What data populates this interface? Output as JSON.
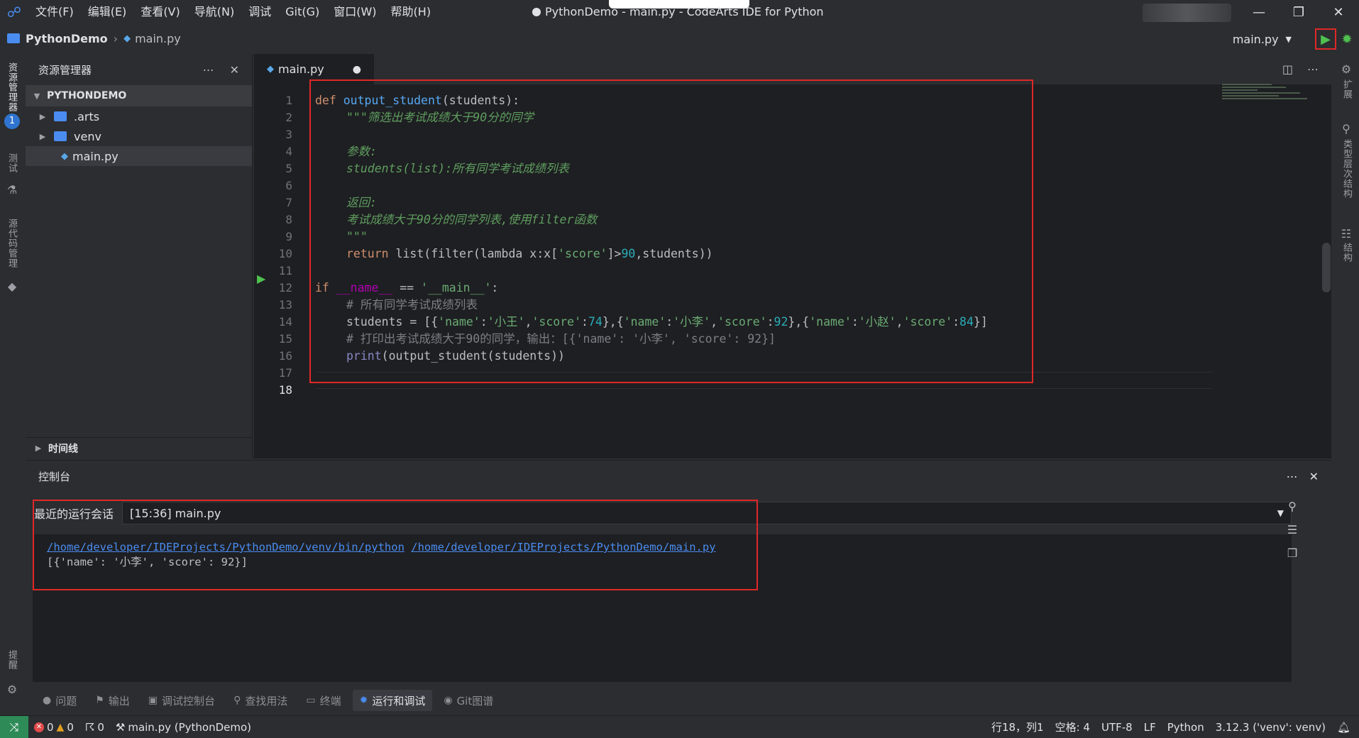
{
  "titlebar": {
    "menus": [
      "文件(F)",
      "编辑(E)",
      "查看(V)",
      "导航(N)",
      "调试",
      "Git(G)",
      "窗口(W)",
      "帮助(H)"
    ],
    "title": "PythonDemo - main.py - CodeArts IDE for Python"
  },
  "breadcrumb": {
    "project": "PythonDemo",
    "file": "main.py"
  },
  "run_config": {
    "selected": "main.py"
  },
  "activity": {
    "explorer_label": "资源管理器",
    "badge": "1",
    "test_label": "测试",
    "scm_label": "源代码管理",
    "bottom_label": "提醒"
  },
  "right_strip": {
    "ext_label": "扩展",
    "hier_label": "类型层次结构",
    "struct_label": "结构"
  },
  "explorer": {
    "title": "资源管理器",
    "project": "PYTHONDEMO",
    "items": [
      ".arts",
      "venv",
      "main.py"
    ],
    "timeline": "时间线"
  },
  "editor": {
    "tab": "main.py",
    "modified": "●",
    "line_numbers": [
      "1",
      "2",
      "3",
      "4",
      "5",
      "6",
      "7",
      "8",
      "9",
      "10",
      "11",
      "12",
      "13",
      "14",
      "15",
      "16",
      "17",
      "18"
    ],
    "code": {
      "l1_def": "def",
      "l1_fn": "output_student",
      "l1_rest": "(students):",
      "l2": "\"\"\"筛选出考试成绩大于90分的同学",
      "l4": "参数:",
      "l5": "students(list):所有同学考试成绩列表",
      "l7": "返回:",
      "l8": "考试成绩大于90分的同学列表,使用filter函数",
      "l9": "\"\"\"",
      "l10_kw": "return",
      "l10_a": "list(filter(lambda x:x[",
      "l10_s": "'score'",
      "l10_b": "]>",
      "l10_n": "90",
      "l10_c": ",students))",
      "l12_if": "if",
      "l12_name": "__name__",
      "l12_eq": " == ",
      "l12_s": "'__main__'",
      "l12_c": ":",
      "l13": "# 所有同学考试成绩列表",
      "l14_a": "students = [{",
      "l14_k1": "'name'",
      "l14_v1": "'小王'",
      "l14_k2": "'score'",
      "l14_n1": "74",
      "l14_k3": "'name'",
      "l14_v2": "'小李'",
      "l14_k4": "'score'",
      "l14_n2": "92",
      "l14_k5": "'name'",
      "l14_v3": "'小赵'",
      "l14_k6": "'score'",
      "l14_n3": "84",
      "l15": "# 打印出考试成绩大于90的同学，输出：[{'name': '小李', 'score': 92}]",
      "l16_fn": "print",
      "l16_rest": "(output_student(students))"
    }
  },
  "console": {
    "title": "控制台",
    "session_label": "最近的运行会话",
    "session_value": "[15:36] main.py",
    "output_link1": "/home/developer/IDEProjects/PythonDemo/venv/bin/python",
    "output_link2": "/home/developer/IDEProjects/PythonDemo/main.py",
    "output_result": "[{'name': '小李', 'score': 92}]"
  },
  "tool_tabs": [
    "问题",
    "输出",
    "调试控制台",
    "查找用法",
    "终端",
    "运行和调试",
    "Git图谱"
  ],
  "statusbar": {
    "errors": "0",
    "warnings": "0",
    "ports": "0",
    "run_target": "main.py (PythonDemo)",
    "position": "行18，列1",
    "indent": "空格: 4",
    "encoding": "UTF-8",
    "eol": "LF",
    "language": "Python",
    "interpreter": "3.12.3 ('venv': venv)"
  },
  "colors": {
    "accent": "#4a8cf0",
    "highlight_box": "#e02828",
    "run_green": "#4fc14f"
  }
}
